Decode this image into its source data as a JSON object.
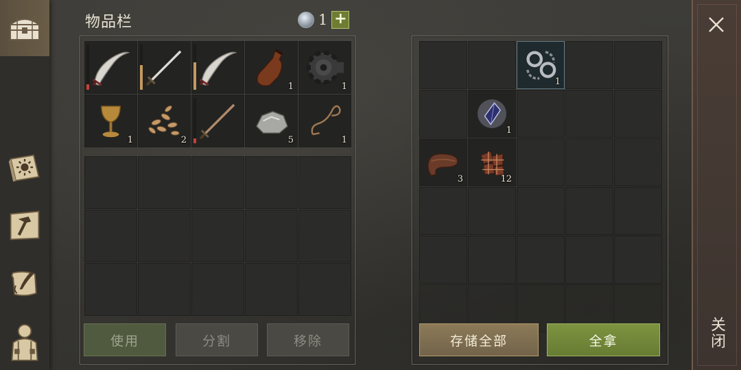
{
  "inventory": {
    "title": "物品栏",
    "capacity_value": "1",
    "slots": [
      {
        "name": "scimitar",
        "icon": "scimitar-icon",
        "qty": "",
        "durability": 0.12,
        "dur_color": "#c0443a"
      },
      {
        "name": "longsword",
        "icon": "longsword-icon",
        "qty": "",
        "durability": 0.55,
        "dur_color": "#c49a60"
      },
      {
        "name": "scimitar",
        "icon": "scimitar-icon",
        "qty": "",
        "durability": 0.6,
        "dur_color": "#c49a60"
      },
      {
        "name": "bottle",
        "icon": "bottle-icon",
        "qty": "1"
      },
      {
        "name": "gear",
        "icon": "gear-icon",
        "qty": "1"
      },
      {
        "name": "goblet",
        "icon": "goblet-icon",
        "qty": "1"
      },
      {
        "name": "seeds",
        "icon": "seeds-icon",
        "qty": "2"
      },
      {
        "name": "rusty-sword",
        "icon": "sword-icon",
        "qty": "",
        "durability": 0.1,
        "dur_color": "#c0443a"
      },
      {
        "name": "stone",
        "icon": "stone-icon",
        "qty": "5"
      },
      {
        "name": "rope",
        "icon": "rope-icon",
        "qty": "1"
      }
    ],
    "buttons": {
      "use": "使用",
      "split": "分割",
      "remove": "移除"
    }
  },
  "container": {
    "slots": [
      {
        "index": 2,
        "name": "shackles",
        "icon": "shackles-icon",
        "qty": "1",
        "highlight": true
      },
      {
        "index": 6,
        "name": "crystal",
        "icon": "crystal-icon",
        "qty": "1"
      },
      {
        "index": 10,
        "name": "leather",
        "icon": "leather-icon",
        "qty": "3"
      },
      {
        "index": 11,
        "name": "leather-scraps",
        "icon": "scraps-icon",
        "qty": "12"
      }
    ],
    "buttons": {
      "store_all": "存储全部",
      "take_all": "全拿"
    }
  },
  "close": {
    "label": "关闭"
  },
  "colors": {
    "accent_green": "#7d9340",
    "accent_tan": "#8c7a58"
  }
}
